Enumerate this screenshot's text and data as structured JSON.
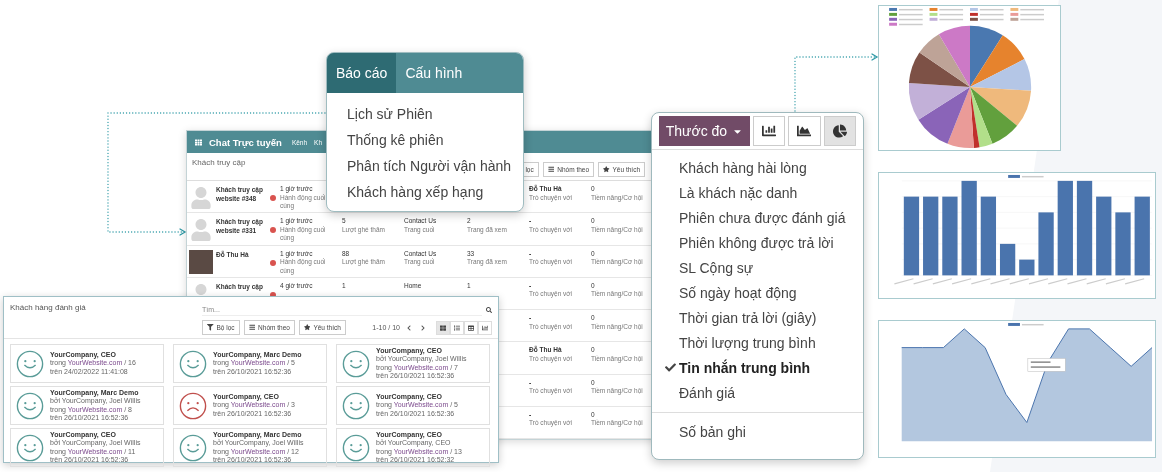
{
  "back_window": {
    "title": "Chat Trực tuyến",
    "menu": [
      "Kênh",
      "Kh"
    ],
    "breadcrumb": "Khách truy cập",
    "buttons": [
      {
        "kind": "filter",
        "label": "lọc"
      },
      {
        "kind": "group",
        "label": "Nhóm theo"
      },
      {
        "kind": "favorite",
        "label": "Yêu thích"
      }
    ],
    "rows": [
      {
        "avatar": {
          "kind": "silhouette"
        },
        "name": "Khách truy cập website #348",
        "color": "#d9534f",
        "last_action": {
          "value": "1 giờ trước",
          "label": "Hành động cuối cùng"
        },
        "chat_with": {
          "value": "Đỗ Thu Hà",
          "label": "Trò chuyện với"
        },
        "leads": {
          "value": "0",
          "label": "Tiềm năng/Cơ hội"
        }
      },
      {
        "avatar": {
          "kind": "silhouette"
        },
        "name": "Khách truy cập website #331",
        "color": "#d9534f",
        "last_action": {
          "value": "1 giờ trước",
          "label": "Hành động cuối cùng"
        },
        "visits": {
          "value": "5",
          "label": "Lượt ghé thăm"
        },
        "last_page": {
          "value": "Contact Us",
          "label": "Trang cuối"
        },
        "pages": {
          "value": "2",
          "label": "Trang đã xem"
        },
        "chat_with": {
          "value": "-",
          "label": "Trò chuyện với"
        },
        "leads": {
          "value": "0",
          "label": "Tiềm năng/Cơ hội"
        }
      },
      {
        "avatar": {
          "kind": "photo"
        },
        "name": "Đỗ Thu Hà",
        "color": "#d9534f",
        "last_action": {
          "value": "1 giờ trước",
          "label": "Hành động cuối cùng"
        },
        "visits": {
          "value": "88",
          "label": "Lượt ghé thăm"
        },
        "last_page": {
          "value": "Contact Us",
          "label": "Trang cuối"
        },
        "pages": {
          "value": "33",
          "label": "Trang đã xem"
        },
        "chat_with": {
          "value": "-",
          "label": "Trò chuyện với"
        },
        "leads": {
          "value": "0",
          "label": "Tiềm năng/Cơ hội"
        }
      },
      {
        "avatar": {
          "kind": "silhouette"
        },
        "name": "Khách truy cập",
        "color": "#d9534f",
        "last_action": {
          "value": "4 giờ trước"
        },
        "visits": {
          "value": "1"
        },
        "last_page": {
          "value": "Home"
        },
        "pages": {
          "value": "1"
        },
        "chat_with": {
          "value": "-",
          "label": "Trò chuyện với"
        },
        "leads": {
          "value": "0",
          "label": "Tiềm năng/Cơ hội"
        }
      },
      {
        "chat_with": {
          "value": "-",
          "label": "Trò chuyện với"
        },
        "leads": {
          "value": "0",
          "label": "Tiềm năng/Cơ hội"
        }
      },
      {
        "chat_with": {
          "value": "Đỗ Thu Hà",
          "label": "Trò chuyện với"
        },
        "leads": {
          "value": "0",
          "label": "Tiềm năng/Cơ hội"
        }
      },
      {
        "chat_with": {
          "value": "-",
          "label": "Trò chuyện với"
        },
        "leads": {
          "value": "0",
          "label": "Tiềm năng/Cơ hội"
        }
      },
      {
        "chat_with": {
          "value": "-",
          "label": "Trò chuyện với"
        },
        "leads": {
          "value": "0",
          "label": "Tiềm năng/Cơ hội"
        }
      }
    ]
  },
  "report_menu": {
    "tabs": [
      {
        "label": "Báo cáo",
        "selected": true
      },
      {
        "label": "Cấu hình",
        "selected": false
      }
    ],
    "items": [
      "Lịch sử Phiên",
      "Thống kê phiên",
      "Phân tích Người vận hành",
      "Khách hàng xếp hạng"
    ]
  },
  "measure_menu": {
    "button": "Thước đo",
    "views": [
      {
        "kind": "bar",
        "selected": false
      },
      {
        "kind": "area",
        "selected": false
      },
      {
        "kind": "pie",
        "selected": true
      }
    ],
    "items": [
      {
        "label": "Khách hàng hài lòng",
        "checked": false
      },
      {
        "label": "Là khách nặc danh",
        "checked": false
      },
      {
        "label": "Phiên chưa được đánh giá",
        "checked": false
      },
      {
        "label": "Phiên không được trả lời",
        "checked": false
      },
      {
        "label": "SL Cộng sự",
        "checked": false
      },
      {
        "label": "Số ngày hoạt động",
        "checked": false
      },
      {
        "label": "Thời gian trả lời (giây)",
        "checked": false
      },
      {
        "label": "Thời lượng trung bình",
        "checked": false
      },
      {
        "label": "Tin nhắn trung bình",
        "checked": true
      },
      {
        "label": "Đánh giá",
        "checked": false
      }
    ],
    "footer_item": "Số bản ghi"
  },
  "ratings_window": {
    "title": "Khách hàng đánh giá",
    "search": {
      "placeholder": "Tìm..."
    },
    "buttons": [
      {
        "kind": "filter",
        "label": "Bộ lọc"
      },
      {
        "kind": "group",
        "label": "Nhóm theo"
      },
      {
        "kind": "favorite",
        "label": "Yêu thích"
      }
    ],
    "pager": "1-10 / 10",
    "views": [
      {
        "kind": "kanban",
        "selected": true
      },
      {
        "kind": "list",
        "selected": false
      },
      {
        "kind": "pivot",
        "selected": false
      },
      {
        "kind": "graph",
        "selected": false
      }
    ],
    "cards": [
      {
        "kind": "happy",
        "title": "YourCompany, CEO",
        "lines": [
          {
            "prefix": "trong",
            "link": "YourWebsite.com",
            "suffix": "/ 16"
          },
          {
            "text": "trên 24/02/2022 11:41:08"
          }
        ]
      },
      {
        "kind": "happy",
        "title": "YourCompany, Marc Demo",
        "lines": [
          {
            "prefix": "trong",
            "link": "YourWebsite.com",
            "suffix": "/ 5"
          },
          {
            "text": "trên 26/10/2021 16:52:36"
          }
        ]
      },
      {
        "kind": "happy",
        "title": "YourCompany, CEO",
        "lines": [
          {
            "text": "bởi YourCompany, Joel Willis"
          },
          {
            "prefix": "trong",
            "link": "YourWebsite.com",
            "suffix": "/ 7"
          },
          {
            "text": "trên 26/10/2021 16:52:36"
          }
        ]
      },
      {
        "kind": "happy",
        "title": "YourCompany, Marc Demo",
        "lines": [
          {
            "text": "bởi YourCompany, Joel Willis"
          },
          {
            "prefix": "trong",
            "link": "YourWebsite.com",
            "suffix": "/ 8"
          },
          {
            "text": "trên 26/10/2021 16:52:36"
          }
        ]
      },
      {
        "kind": "sad",
        "title": "YourCompany, CEO",
        "lines": [
          {
            "prefix": "trong",
            "link": "YourWebsite.com",
            "suffix": "/ 3"
          },
          {
            "text": "trên 26/10/2021 16:52:36"
          }
        ]
      },
      {
        "kind": "happy",
        "title": "YourCompany, CEO",
        "lines": [
          {
            "prefix": "trong",
            "link": "YourWebsite.com",
            "suffix": "/ 5"
          },
          {
            "text": "trên 26/10/2021 16:52:36"
          }
        ]
      },
      {
        "kind": "happy",
        "title": "YourCompany, CEO",
        "lines": [
          {
            "text": "bởi YourCompany, Joel Willis"
          },
          {
            "prefix": "trong",
            "link": "YourWebsite.com",
            "suffix": "/ 11"
          },
          {
            "text": "trên 26/10/2021 16:52:36"
          }
        ]
      },
      {
        "kind": "happy",
        "title": "YourCompany, Marc Demo",
        "lines": [
          {
            "text": "bởi YourCompany, Joel Willis"
          },
          {
            "prefix": "trong",
            "link": "YourWebsite.com",
            "suffix": "/ 12"
          },
          {
            "text": "trên 26/10/2021 16:52:36"
          }
        ]
      },
      {
        "kind": "happy",
        "title": "YourCompany, CEO",
        "lines": [
          {
            "text": "bởi YourCompany, CEO"
          },
          {
            "prefix": "trong",
            "link": "YourWebsite.com",
            "suffix": "/ 13"
          },
          {
            "text": "trên 26/10/2021 16:52:32"
          }
        ]
      }
    ]
  }
}
